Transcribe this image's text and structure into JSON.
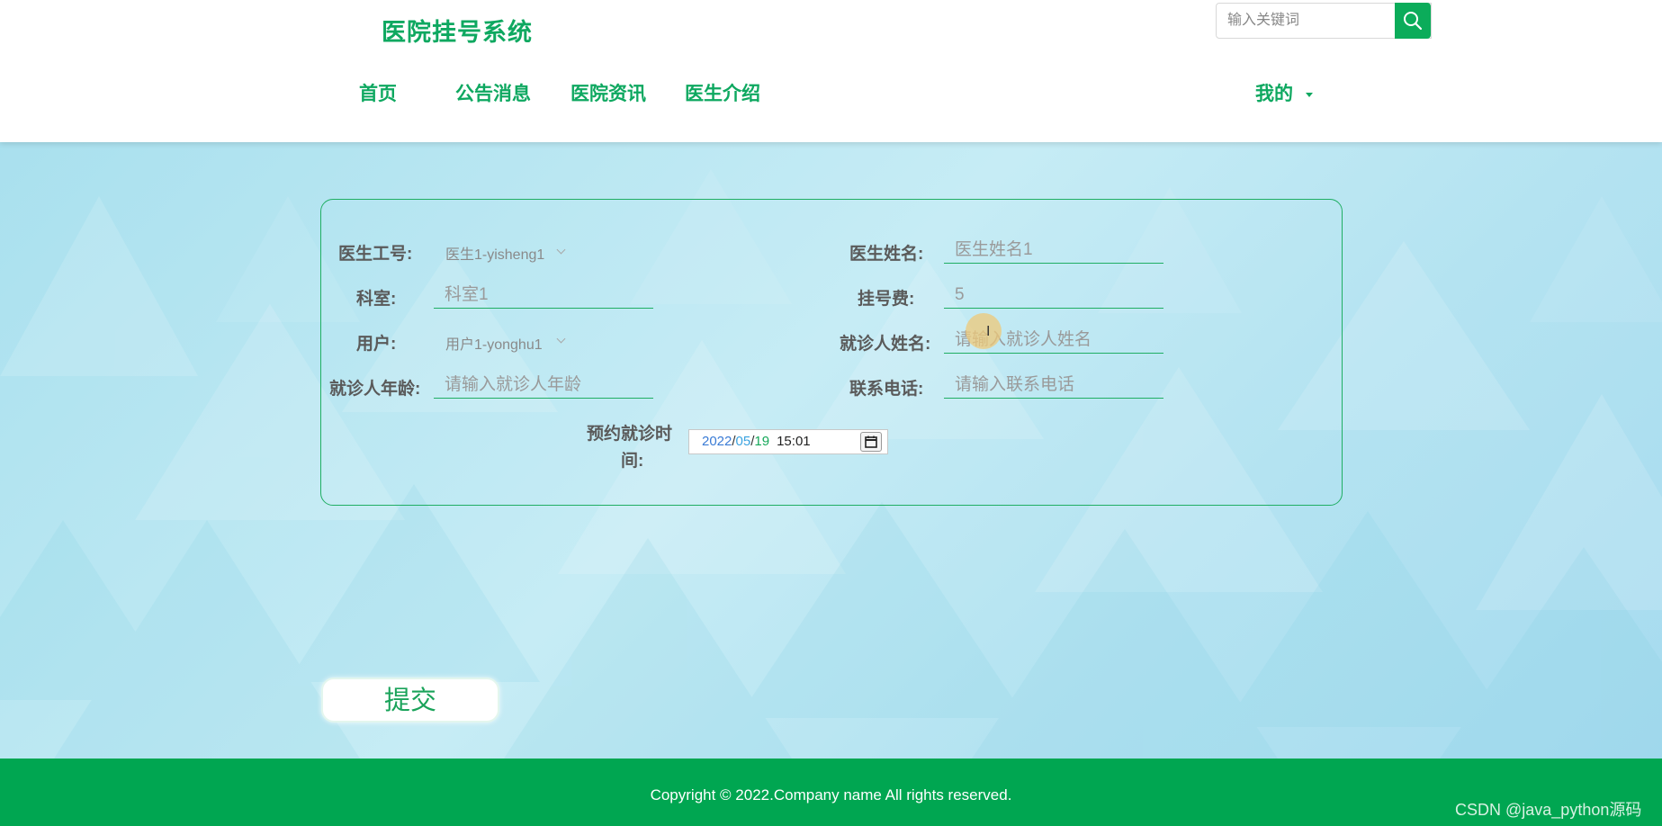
{
  "header": {
    "site_title": "医院挂号系统",
    "search_placeholder": "输入关键词",
    "nav": [
      "首页",
      "公告消息",
      "医院资讯",
      "医生介绍"
    ],
    "mine_label": "我的"
  },
  "form": {
    "doctor_id_label": "医生工号:",
    "doctor_id_value": "医生1-yisheng1",
    "doctor_name_label": "医生姓名:",
    "doctor_name_value": "医生姓名1",
    "department_label": "科室:",
    "department_value": "科室1",
    "fee_label": "挂号费:",
    "fee_value": "5",
    "user_label": "用户:",
    "user_value": "用户1-yonghu1",
    "patient_name_label": "就诊人姓名:",
    "patient_name_placeholder": "请输入就诊人姓名",
    "patient_age_label": "就诊人年龄:",
    "patient_age_placeholder": "请输入就诊人年龄",
    "phone_label": "联系电话:",
    "phone_placeholder": "请输入联系电话",
    "appointment_label_1": "预约就诊时",
    "appointment_label_2": "间:",
    "date_year": "2022",
    "date_month": "05",
    "date_day": "19",
    "date_time": "15:01",
    "submit_label": "提交"
  },
  "footer": {
    "copyright": "Copyright © 2022.Company name All rights reserved.",
    "watermark": "CSDN @java_python源码"
  },
  "colors": {
    "brand_green": "#0ea860",
    "footer_green": "#00a651"
  }
}
